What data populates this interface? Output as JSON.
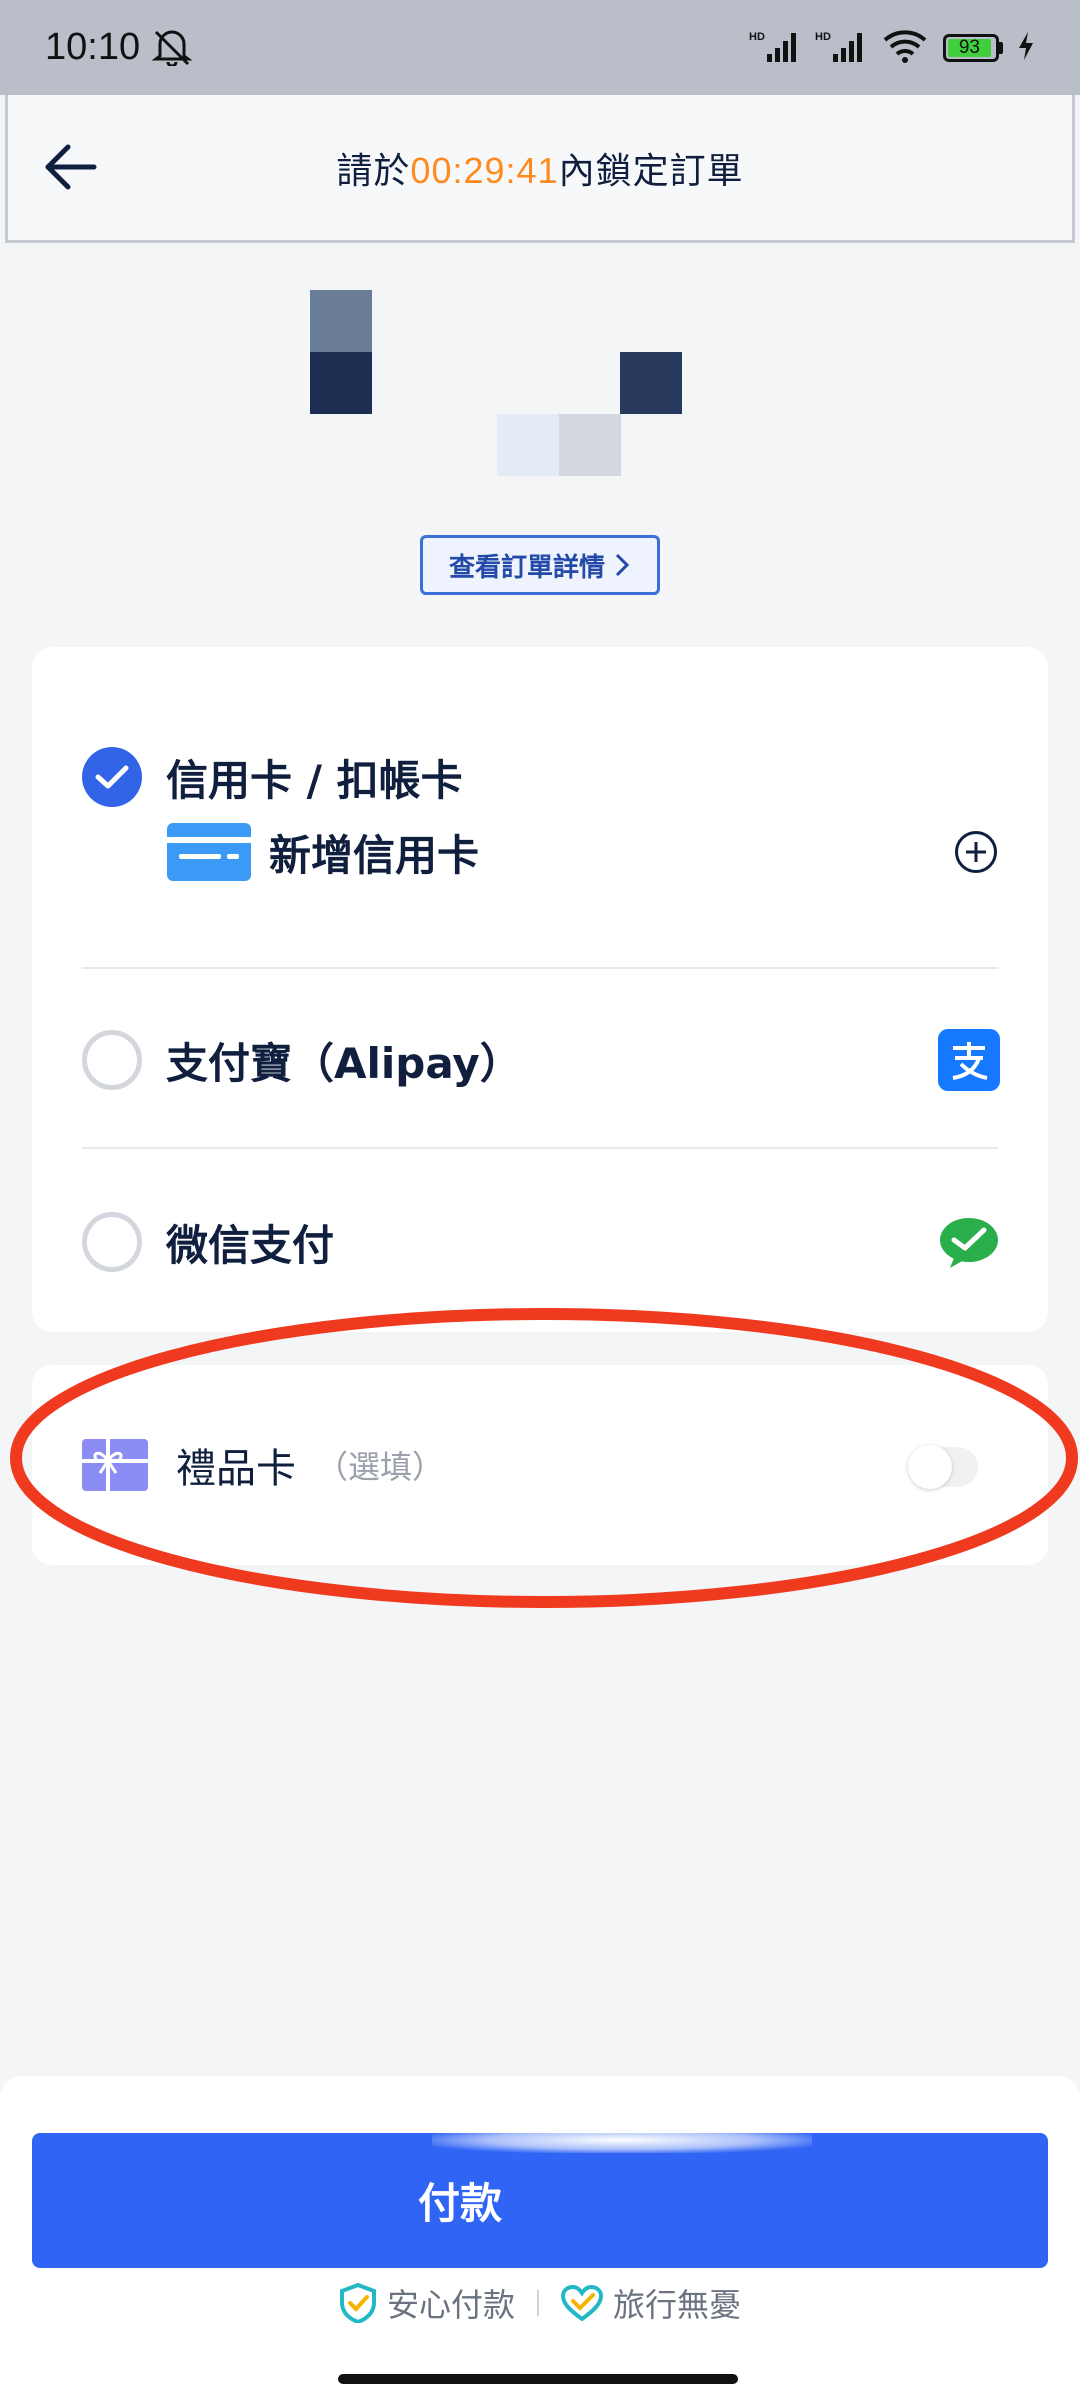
{
  "status_bar": {
    "time": "10:10",
    "battery_level": "93",
    "icons": [
      "mute-bell-icon",
      "hd-signal-icon",
      "hd-signal-icon",
      "wifi-icon",
      "battery-icon",
      "charging-icon"
    ]
  },
  "header": {
    "title_prefix": "請於",
    "countdown": "00:29:41",
    "title_suffix": "內鎖定訂單"
  },
  "order": {
    "details_label": "查看訂單詳情"
  },
  "payment": {
    "credit_card_label": "信用卡 / 扣帳卡",
    "add_card_label": "新增信用卡",
    "alipay_label": "支付寶（Alipay）",
    "wechat_label": "微信支付",
    "selected": "credit_card"
  },
  "gift_card": {
    "label": "禮品卡",
    "optional": "（選填）",
    "enabled": false
  },
  "footer": {
    "pay_label": "付款",
    "trust_secure": "安心付款",
    "trust_travel": "旅行無憂"
  },
  "colors": {
    "accent": "#2f64f5",
    "countdown": "#ff8a1f",
    "highlight_oval": "#f03a1f"
  }
}
